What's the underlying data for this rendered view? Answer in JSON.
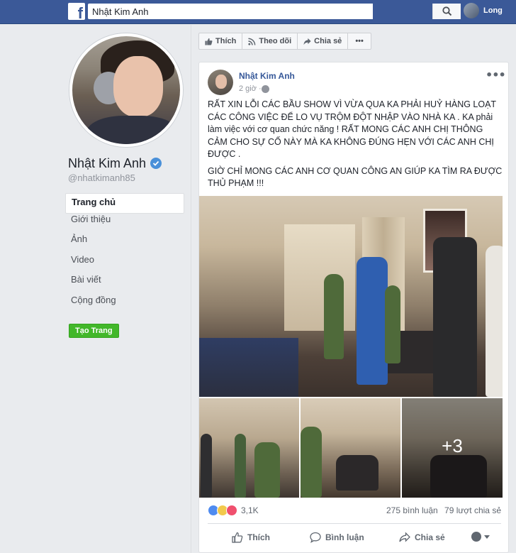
{
  "topbar": {
    "logo": "f",
    "search_value": "Nhật Kim Anh",
    "user_name": "Long",
    "brand_color": "#3b5998"
  },
  "profile": {
    "name": "Nhật Kim Anh",
    "handle": "@nhatkimanh85",
    "verified": true
  },
  "nav": {
    "items": [
      {
        "label": "Trang chủ",
        "active": true
      },
      {
        "label": "Giới thiệu"
      },
      {
        "label": "Ảnh"
      },
      {
        "label": "Video"
      },
      {
        "label": "Bài viết"
      },
      {
        "label": "Cộng đồng"
      }
    ],
    "create_page": "Tạo Trang"
  },
  "page_actions": {
    "like": "Thích",
    "follow": "Theo dõi",
    "share": "Chia sẻ",
    "more": "•••"
  },
  "post": {
    "author": "Nhật Kim Anh",
    "time": "2 giờ ·",
    "menu": "•••",
    "paragraph_1": "RẤT XIN LỖI CÁC BẦU SHOW VÌ VỪA QUA KA PHẢI HUỶ HÀNG LOẠT CÁC CÔNG VIỆC ĐỂ LO VỤ TRỘM ĐỘT NHẬP VÀO NHÀ KA . KA phải làm việc với cơ quan chức năng ! RẤT MONG CÁC ANH CHỊ THÔNG CẢM CHO SỰ CỐ NÀY MÀ KA KHÔNG ĐÚNG HẸN VỚI CÁC ANH CHỊ ĐƯỢC .",
    "paragraph_2": "GIỜ CHỈ MONG CÁC ANH CƠ QUAN CÔNG AN GIÚP KA TÌM RA ĐƯỢC THỦ PHẠM !!!",
    "extra_photos": "+3",
    "reaction_count": "3,1K",
    "comments": "275 bình luận",
    "shares": "79 lượt chia sẻ",
    "actions": {
      "like": "Thích",
      "comment": "Bình luận",
      "share": "Chia sẻ"
    }
  }
}
